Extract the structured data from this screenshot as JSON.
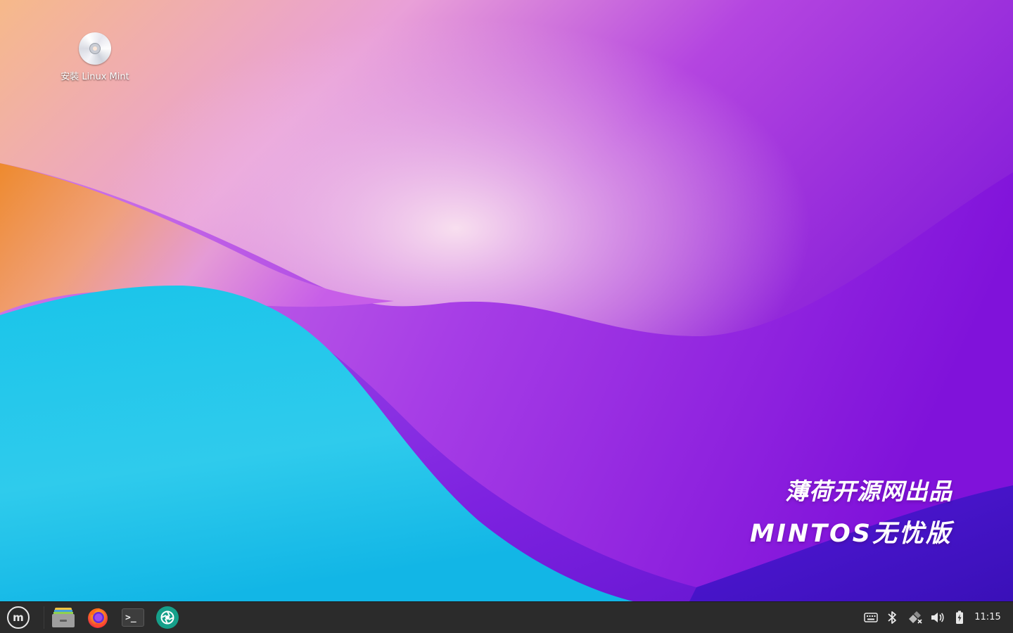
{
  "desktop": {
    "icons": [
      {
        "label": "安裝 Linux Mint",
        "icon": "disc-installer-icon"
      }
    ],
    "wallpaper_text": {
      "line1": "薄荷开源网出品",
      "line2": "MINTOS无忧版"
    }
  },
  "taskbar": {
    "menu_button": {
      "icon": "linux-mint-logo-icon",
      "glyph": "m"
    },
    "launchers": [
      {
        "name": "Files",
        "icon": "file-manager-icon"
      },
      {
        "name": "Firefox",
        "icon": "firefox-icon"
      },
      {
        "name": "Terminal",
        "icon": "terminal-icon",
        "glyph": ">_"
      },
      {
        "name": "Application",
        "icon": "aperture-icon"
      }
    ],
    "tray": [
      {
        "icon": "keyboard-icon"
      },
      {
        "icon": "bluetooth-icon"
      },
      {
        "icon": "network-disconnected-icon"
      },
      {
        "icon": "volume-icon"
      },
      {
        "icon": "battery-charging-icon"
      }
    ],
    "clock": "11:15"
  },
  "colors": {
    "taskbar_bg": "#2b2b2b",
    "wallpaper_orange": "#f0903a",
    "wallpaper_cyan": "#24c3e8",
    "wallpaper_violet": "#8a1fe0",
    "wallpaper_pink": "#f2c8e6"
  }
}
